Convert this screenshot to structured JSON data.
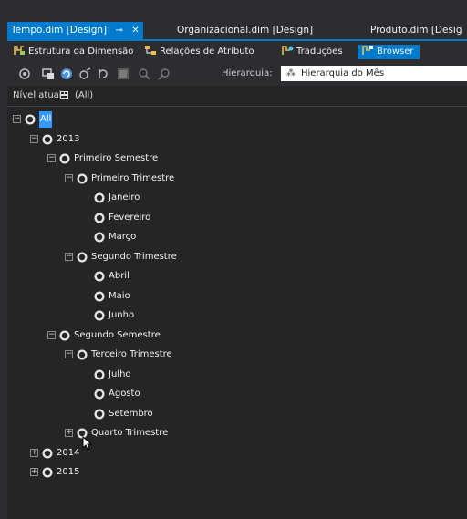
{
  "tabs": [
    {
      "label": "Tempo.dim [Design]",
      "pin": "⊸",
      "close": "✕",
      "active": true
    },
    {
      "label": "Organizacional.dim [Design]",
      "active": false
    },
    {
      "label": "Produto.dim [Desig",
      "active": false
    }
  ],
  "designer_tabs": [
    {
      "label": "Estrutura da Dimensão",
      "icon": "dimension-structure-icon",
      "active": false
    },
    {
      "label": "Relações de Atributo",
      "icon": "attribute-relationships-icon",
      "active": false
    },
    {
      "label": "Traduções",
      "icon": "translations-icon",
      "active": false
    },
    {
      "label": "Browser",
      "icon": "browser-icon",
      "active": true
    }
  ],
  "toolbar": {
    "hierarchy_label": "Hierarquia:",
    "hierarchy_value": "Hierarquia do Mês",
    "icons": [
      "process-icon",
      "reconnect-icon",
      "refresh-icon",
      "member-properties-icon",
      "undo-icon",
      "filter-icon",
      "zoom-in-icon",
      "zoom-out-icon"
    ]
  },
  "level": {
    "label": "Nível atual:",
    "value": "(All)"
  },
  "tree": [
    {
      "label": "All",
      "depth": 0,
      "expander": "minus",
      "selected": true
    },
    {
      "label": "2013",
      "depth": 1,
      "expander": "minus"
    },
    {
      "label": "Primeiro Semestre",
      "depth": 2,
      "expander": "minus"
    },
    {
      "label": "Primeiro Trimestre",
      "depth": 3,
      "expander": "minus"
    },
    {
      "label": "Janeiro",
      "depth": 4,
      "expander": "none"
    },
    {
      "label": "Fevereiro",
      "depth": 4,
      "expander": "none"
    },
    {
      "label": "Março",
      "depth": 4,
      "expander": "none"
    },
    {
      "label": "Segundo Trimestre",
      "depth": 3,
      "expander": "minus"
    },
    {
      "label": "Abril",
      "depth": 4,
      "expander": "none"
    },
    {
      "label": "Maio",
      "depth": 4,
      "expander": "none"
    },
    {
      "label": "Junho",
      "depth": 4,
      "expander": "none"
    },
    {
      "label": "Segundo Semestre",
      "depth": 2,
      "expander": "minus"
    },
    {
      "label": "Terceiro Trimestre",
      "depth": 3,
      "expander": "minus"
    },
    {
      "label": "Julho",
      "depth": 4,
      "expander": "none"
    },
    {
      "label": "Agosto",
      "depth": 4,
      "expander": "none"
    },
    {
      "label": "Setembro",
      "depth": 4,
      "expander": "none"
    },
    {
      "label": "Quarto Trimestre",
      "depth": 3,
      "expander": "plus"
    },
    {
      "label": "2014",
      "depth": 1,
      "expander": "plus"
    },
    {
      "label": "2015",
      "depth": 1,
      "expander": "plus"
    }
  ],
  "colors": {
    "accent": "#007acc",
    "background": "#2d2d30",
    "tree_bg": "#252526",
    "selection": "#3399ff"
  }
}
